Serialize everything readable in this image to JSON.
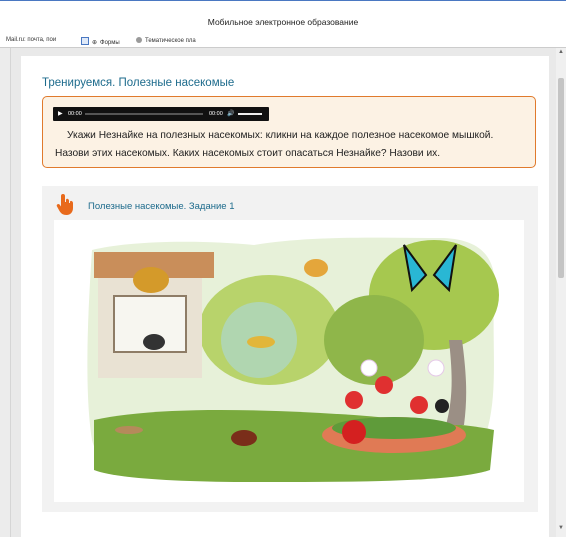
{
  "window": {
    "title": "Мобильное электронное образование"
  },
  "bookmarks": [
    {
      "label": "Mail.ru: почта, пои",
      "icon": "mailru-icon"
    },
    {
      "label": "Формы",
      "icon": "forms-icon"
    },
    {
      "label": "Тематическое пла",
      "icon": "gear-icon"
    }
  ],
  "lesson": {
    "title": "Тренируемся. Полезные насекомые",
    "player": {
      "current_time": "00:00",
      "duration": "00:00"
    },
    "instructions": "Укажи Незнайке на полезных насекомых: кликни на каждое полезное насекомое мышкой. Назови этих насекомых. Каких насекомых стоит опасаться Незнайке? Назови их."
  },
  "exercise": {
    "title": "Полезные насекомые. Задание 1",
    "image_icon": "garden-insects-illustration"
  },
  "colors": {
    "accent_orange": "#e07a2c",
    "title_teal": "#1d6b8c",
    "task_bg": "#fcf2e4"
  }
}
